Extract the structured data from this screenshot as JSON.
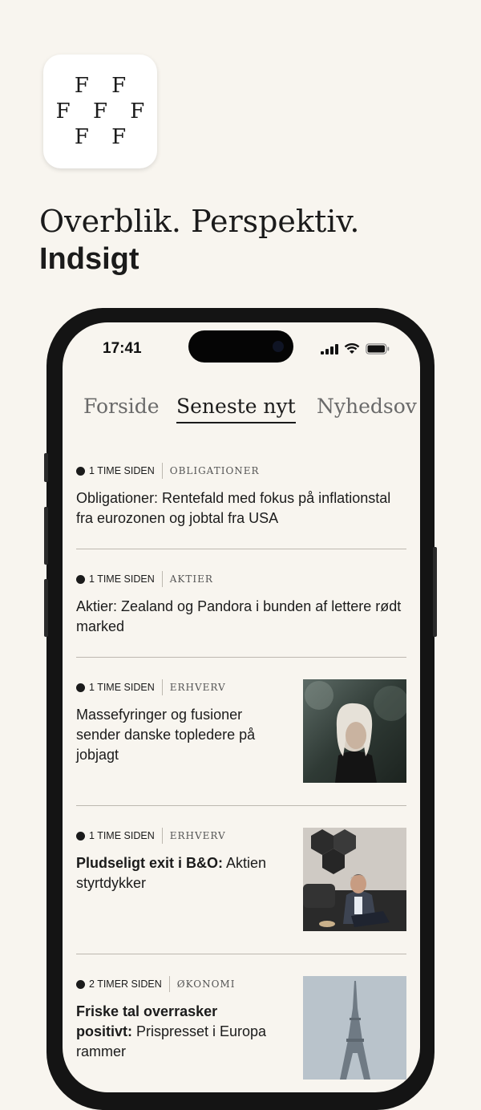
{
  "app": {
    "logo_rows": [
      "F F",
      "F F F",
      "F F"
    ],
    "tagline_line1": "Overblik. Perspektiv.",
    "tagline_line2": "Indsigt"
  },
  "statusbar": {
    "time": "17:41"
  },
  "tabs": [
    {
      "label": "Forside"
    },
    {
      "label": "Seneste nyt",
      "active": true
    },
    {
      "label": "Nyhedsov"
    }
  ],
  "articles": [
    {
      "time": "1 TIME SIDEN",
      "category": "OBLIGATIONER",
      "bold": "",
      "title": "Obligationer: Rentefald med fokus på inflationstal fra eurozonen og jobtal fra USA"
    },
    {
      "time": "1 TIME SIDEN",
      "category": "AKTIER",
      "bold": "",
      "title": "Aktier: Zealand og Pandora i bunden af lettere rødt marked"
    },
    {
      "time": "1 TIME SIDEN",
      "category": "ERHVERV",
      "bold": "",
      "title": "Massefyringer og fusioner sender danske topledere på jobjagt"
    },
    {
      "time": "1 TIME SIDEN",
      "category": "ERHVERV",
      "bold": "Pludseligt exit i B&O:",
      "title": " Aktien styrtdykker"
    },
    {
      "time": "2 TIMER SIDEN",
      "category": "ØKONOMI",
      "bold": "Friske tal overrasker positivt:",
      "title": " Prispresset i Europa rammer"
    }
  ],
  "colors": {
    "background": "#f8f5ef",
    "text": "#1b1b1b",
    "divider": "#bdb8b0",
    "phone": "#141414"
  }
}
